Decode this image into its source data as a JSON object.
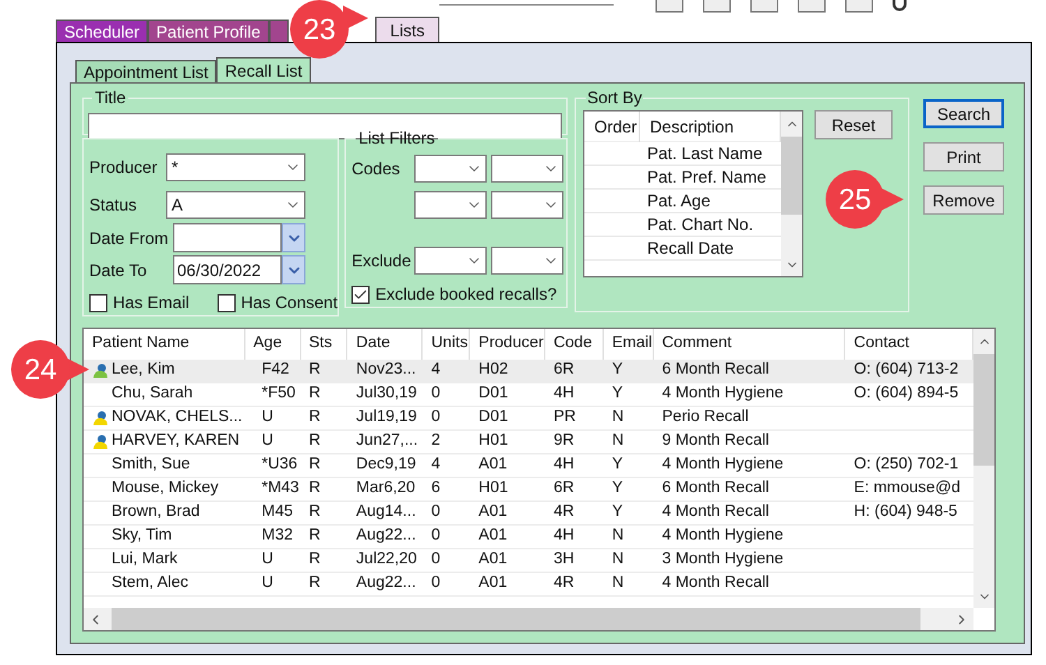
{
  "top_tabs": [
    {
      "label": "Scheduler",
      "selected": false,
      "color": "#9a2fb0"
    },
    {
      "label": "Patient Profile",
      "selected": false,
      "color": "#a2458e"
    },
    {
      "label": "Lists",
      "selected": true,
      "color": "#ecdcec"
    }
  ],
  "sub_tabs": [
    {
      "label": "Appointment List",
      "selected": false
    },
    {
      "label": "Recall List",
      "selected": true
    }
  ],
  "title_field": {
    "label": "Title"
  },
  "producer": {
    "label": "Producer",
    "value": "*"
  },
  "status": {
    "label": "Status",
    "value": "A"
  },
  "date_from": {
    "label": "Date From"
  },
  "date_to": {
    "label": "Date To",
    "value": "06/30/2022"
  },
  "has_email": {
    "label": "Has Email",
    "checked": false
  },
  "has_consent": {
    "label": "Has Consent",
    "checked": false
  },
  "list_filters": {
    "title": "List Filters",
    "codes_label": "Codes",
    "exclude_label": "Exclude",
    "exclude_booked": {
      "label": "Exclude booked recalls?",
      "checked": true
    }
  },
  "sort_by": {
    "title": "Sort By",
    "columns": [
      "Order",
      "Description"
    ],
    "rows": [
      "Pat. Last Name",
      "Pat. Pref. Name",
      "Pat. Age",
      "Pat. Chart No.",
      "Recall Date"
    ]
  },
  "reset_button": "Reset",
  "buttons": [
    "Search",
    "Print",
    "Remove"
  ],
  "table": {
    "columns": [
      "Patient Name",
      "Age",
      "Sts",
      "Date",
      "Units",
      "Producer",
      "Code",
      "Email",
      "Comment",
      "Contact"
    ],
    "rows": [
      {
        "selected": true,
        "color": "#7cc242",
        "patient_name": "Lee, Kim",
        "age": "F42",
        "sts": "R",
        "date": "Nov23...",
        "units": "4",
        "producer": "H02",
        "code": "6R",
        "email": "Y",
        "comment": "6 Month Recall",
        "contact": "O: (604) 713-2"
      },
      {
        "selected": false,
        "patient_name": "Chu, Sarah",
        "age": "*F50",
        "sts": "R",
        "date": "Jul30,19",
        "units": "0",
        "producer": "D01",
        "code": "4H",
        "email": "Y",
        "comment": "4 Month Hygiene",
        "contact": "O: (604) 894-5"
      },
      {
        "selected": false,
        "color": "#f2d600",
        "patient_name": "NOVAK, CHELS...",
        "age": "U",
        "sts": "R",
        "date": "Jul19,19",
        "units": "0",
        "producer": "D01",
        "code": "PR",
        "email": "N",
        "comment": "Perio Recall"
      },
      {
        "selected": false,
        "color": "#f2d600",
        "patient_name": "HARVEY, KAREN",
        "age": "U",
        "sts": "R",
        "date": "Jun27,...",
        "units": "2",
        "producer": "H01",
        "code": "9R",
        "email": "N",
        "comment": "9 Month Recall"
      },
      {
        "selected": false,
        "patient_name": "Smith, Sue",
        "age": "*U36",
        "sts": "R",
        "date": "Dec9,19",
        "units": "4",
        "producer": "A01",
        "code": "4H",
        "email": "Y",
        "comment": "4 Month Hygiene",
        "contact": "O: (250) 702-1"
      },
      {
        "selected": false,
        "patient_name": "Mouse, Mickey",
        "age": "*M43",
        "sts": "R",
        "date": "Mar6,20",
        "units": "6",
        "producer": "H01",
        "code": "6R",
        "email": "Y",
        "comment": "6 Month Recall",
        "contact": "E: mmouse@d"
      },
      {
        "selected": false,
        "patient_name": "Brown, Brad",
        "age": "M45",
        "sts": "R",
        "date": "Aug14...",
        "units": "0",
        "producer": "A01",
        "code": "4R",
        "email": "Y",
        "comment": "4 Month Recall",
        "contact": "H: (604) 948-5"
      },
      {
        "selected": false,
        "patient_name": "Sky, Tim",
        "age": "M32",
        "sts": "R",
        "date": "Aug22...",
        "units": "0",
        "producer": "A01",
        "code": "4H",
        "email": "N",
        "comment": "4 Month Hygiene"
      },
      {
        "selected": false,
        "patient_name": "Lui, Mark",
        "age": "U",
        "sts": "R",
        "date": "Jul22,20",
        "units": "0",
        "producer": "A01",
        "code": "3H",
        "email": "N",
        "comment": "3 Month Hygiene"
      },
      {
        "selected": false,
        "patient_name": "Stem, Alec",
        "age": "U",
        "sts": "R",
        "date": "Aug22...",
        "units": "0",
        "producer": "A01",
        "code": "4R",
        "email": "N",
        "comment": "4 Month Recall"
      }
    ]
  },
  "callouts": [
    {
      "number": "23"
    },
    {
      "number": "24"
    },
    {
      "number": "25"
    }
  ]
}
